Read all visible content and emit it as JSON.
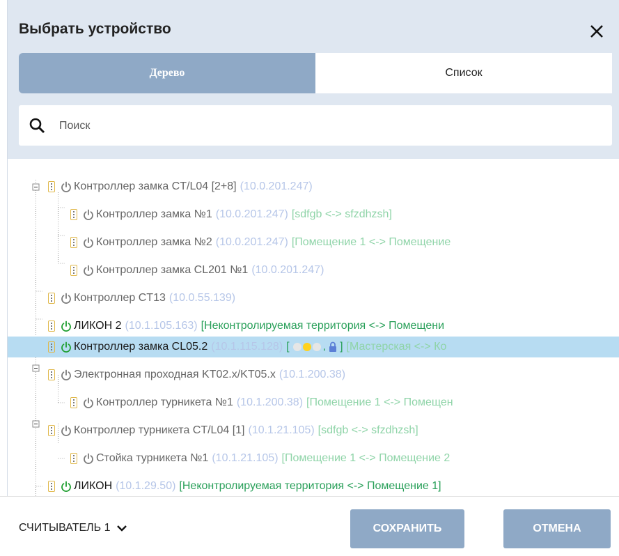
{
  "dialog": {
    "title": "Выбрать устройство"
  },
  "tabs": [
    {
      "label": "Дерево",
      "active": true
    },
    {
      "label": "Список",
      "active": false
    }
  ],
  "search": {
    "placeholder": "Поиск",
    "value": ""
  },
  "tree": [
    {
      "name": "Контроллер замка CT/L04 [2+8]",
      "ip": "(10.0.201.247)",
      "zones": "",
      "online": false,
      "selected": false
    },
    {
      "name": "Контроллер замка №1",
      "ip": "(10.0.201.247)",
      "zones": "[sdfgb <-> sfzdhzsh]",
      "online": false,
      "selected": false
    },
    {
      "name": "Контроллер замка №2",
      "ip": "(10.0.201.247)",
      "zones": "[Помещение 1 <-> Помещение",
      "online": false,
      "selected": false
    },
    {
      "name": "Контроллер замка CL201 №1",
      "ip": "(10.0.201.247)",
      "zones": "",
      "online": false,
      "selected": false
    },
    {
      "name": "Контроллер CT13",
      "ip": "(10.0.55.139)",
      "zones": "",
      "online": false,
      "selected": false
    },
    {
      "name": "ЛИКОН 2",
      "ip": "(10.1.105.163)",
      "zones": "[Неконтролируемая территория <-> Помещени",
      "online": true,
      "selected": false
    },
    {
      "name": "Контроллер замка CL05.2",
      "ip": "(10.1.115.128)",
      "status_open": "[",
      "status_sep": ",",
      "status_close": "]",
      "zones": "[Мастерская <-> Ко",
      "online": true,
      "selected": true
    },
    {
      "name": "Электронная проходная KT02.x/KT05.x",
      "ip": "(10.1.200.38)",
      "zones": "",
      "online": false,
      "selected": false
    },
    {
      "name": "Контроллер турникета №1",
      "ip": "(10.1.200.38)",
      "zones": "[Помещение 1 <-> Помещен",
      "online": false,
      "selected": false
    },
    {
      "name": "Контроллер турникета CT/L04 [1]",
      "ip": "(10.1.21.105)",
      "zones": "[sdfgb <-> sfzdhzsh]",
      "online": false,
      "selected": false
    },
    {
      "name": "Стойка турникета №1",
      "ip": "(10.1.21.105)",
      "zones": "[Помещение 1 <-> Помещение 2",
      "online": false,
      "selected": false
    },
    {
      "name": "ЛИКОН",
      "ip": "(10.1.29.50)",
      "zones": "[Неконтролируемая территория <-> Помещение 1]",
      "online": true,
      "selected": false
    }
  ],
  "footer": {
    "reader_label": "СЧИТЫВАТЕЛЬ 1",
    "save_label": "СОХРАНИТЬ",
    "cancel_label": "ОТМЕНА"
  },
  "colors": {
    "accent": "#8fa9c6",
    "header_bg": "#dfe7f1",
    "selected_row": "#b7dcf2",
    "ip_text": "#b6c6e8",
    "zone_text": "#8fd4a8",
    "online_power": "#1e9e2f",
    "offline_power": "#7a7a7a",
    "lock": "#5b7fd6",
    "indicator_yellow": "#ffd21f",
    "indicator_grey": "#e6e6e6"
  }
}
